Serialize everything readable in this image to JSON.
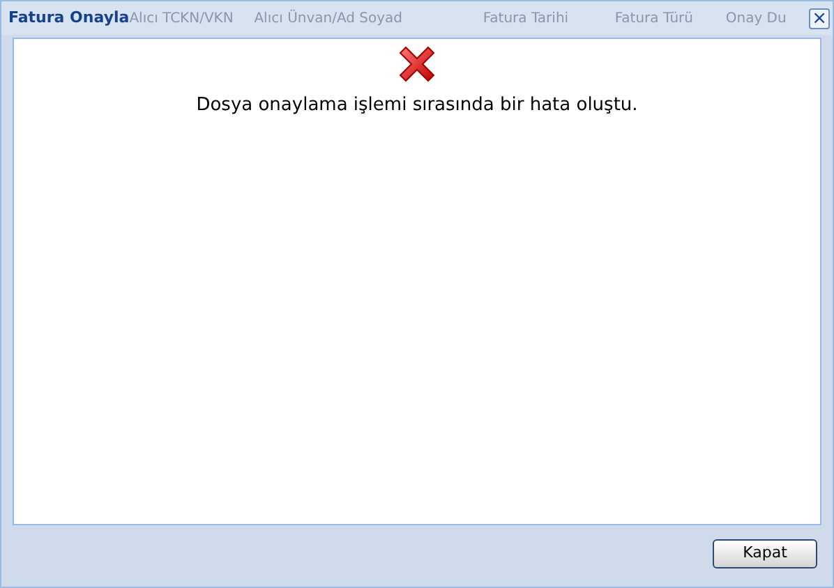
{
  "window": {
    "title": "Fatura Onayla",
    "close": "×"
  },
  "background_columns": [
    "Alıcı TCKN/VKN",
    "Alıcı Ünvan/Ad Soyad",
    "Fatura Tarihi",
    "Fatura Türü",
    "Onay Du"
  ],
  "message": {
    "kind": "error",
    "text": "Dosya onaylama işlemi sırasında bir hata oluştu."
  },
  "buttons": [
    "Kapat"
  ]
}
